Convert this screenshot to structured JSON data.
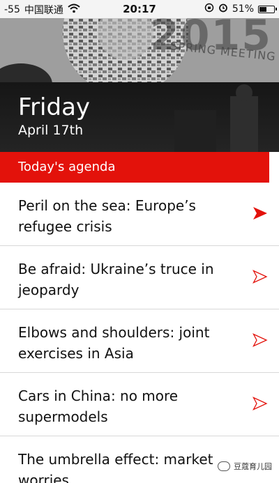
{
  "status_bar": {
    "signal": "-55",
    "carrier": "中国联通",
    "time": "20:17",
    "battery_text": "51%",
    "battery_level": 0.51
  },
  "hero": {
    "year_text": "2015",
    "event_text": "SPRING MEETING",
    "day": "Friday",
    "date": "April 17th"
  },
  "section": {
    "label": "Today's agenda",
    "color": "#e3120b"
  },
  "articles": [
    {
      "title": "Peril on the sea: Europe’s refugee crisis",
      "arrow": "filled",
      "arrow_color": "#e3120b"
    },
    {
      "title": "Be afraid: Ukraine’s truce in jeopardy",
      "arrow": "outline",
      "arrow_color": "#e3120b"
    },
    {
      "title": "Elbows and shoulders: joint exercises in Asia",
      "arrow": "outline",
      "arrow_color": "#e3120b"
    },
    {
      "title": "Cars in China: no more supermodels",
      "arrow": "outline",
      "arrow_color": "#e3120b"
    },
    {
      "title": "The umbrella effect: market worries",
      "arrow": "none",
      "arrow_color": "#e3120b"
    }
  ],
  "watermark": {
    "text": "豆蔻育儿园"
  }
}
